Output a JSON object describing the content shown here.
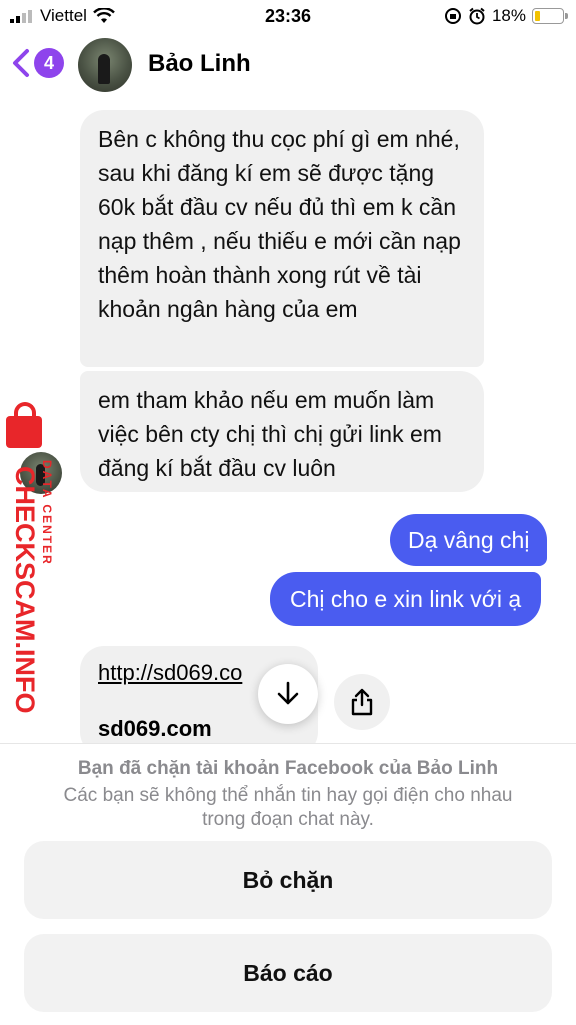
{
  "status_bar": {
    "carrier": "Viettel",
    "time": "23:36",
    "battery": "18%",
    "battery_level": 0.18
  },
  "header": {
    "back_badge": "4",
    "contact_name": "Bảo Linh"
  },
  "messages": [
    {
      "from": "them",
      "text": "Bên c không thu cọc phí gì em nhé, sau khi đăng kí em sẽ được tặng 60k bắt đầu cv nếu đủ thì em k cần nạp thêm , nếu thiếu e mới cần nạp thêm hoàn thành xong rút về tài khoản ngân hàng của em"
    },
    {
      "from": "them",
      "text": "em tham khảo nếu em muốn làm việc bên cty chị thì chị  gửi link em đăng kí bắt đầu cv luôn"
    },
    {
      "from": "me",
      "text": "Dạ vâng chị"
    },
    {
      "from": "me",
      "text": "Chị cho e xin link với ạ"
    }
  ],
  "link_preview": {
    "url": "http://sd069.co",
    "domain": "sd069.com"
  },
  "watermark": {
    "main": "CHECKSCAM.INFO",
    "sub": "DATA CENTER"
  },
  "blocked_panel": {
    "title": "Bạn đã chặn tài khoản Facebook của Bảo Linh",
    "description": "Các bạn sẽ không thể nhắn tin hay gọi điện cho nhau trong đoạn chat này.",
    "unblock_label": "Bỏ chặn",
    "report_label": "Báo cáo"
  },
  "colors": {
    "accent": "#8e44ec",
    "outgoing_bubble": "#4a5cf0",
    "incoming_bubble": "#f0f0f0",
    "watermark": "#e8262a"
  }
}
